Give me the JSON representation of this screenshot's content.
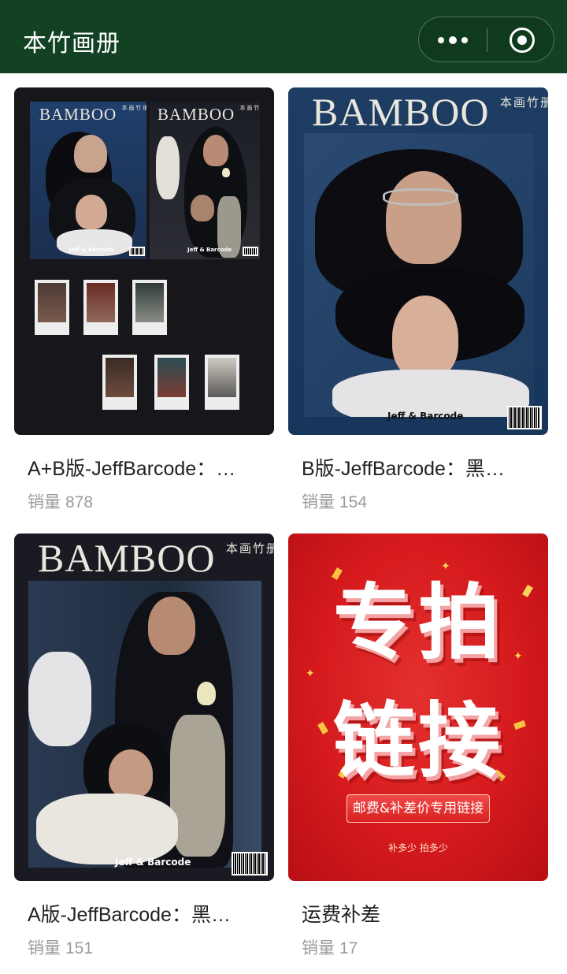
{
  "header": {
    "title": "本竹画册",
    "more_icon": "more-dots-icon",
    "close_icon": "target-circle-icon"
  },
  "colors": {
    "header_bg": "#124223",
    "promo_red": "#d61a1d"
  },
  "products": [
    {
      "title": "A+B版-JeffBarcode：…",
      "sales_label": "销量",
      "sales": "878",
      "cover": {
        "mag_a_brand": "BAMBOO",
        "mag_a_zh": "本画竹册",
        "mag_a_foot": "Jeff & Barcode",
        "mag_b_brand": "BAMBOO",
        "mag_b_zh": "本画竹册",
        "mag_b_foot": "Jeff & Barcode"
      }
    },
    {
      "title": "B版-JeffBarcode：黑…",
      "sales_label": "销量",
      "sales": "154",
      "cover": {
        "brand": "BAMBOO",
        "zh": "本画竹册",
        "foot": "Jeff & Barcode"
      }
    },
    {
      "title": "A版-JeffBarcode：黑…",
      "sales_label": "销量",
      "sales": "151",
      "cover": {
        "brand": "BAMBOO",
        "zh": "本画竹册",
        "foot": "Jeff & Barcode"
      }
    },
    {
      "title": "运费补差",
      "sales_label": "销量",
      "sales": "17",
      "cover": {
        "line1": "专拍",
        "line2": "链接",
        "banner": "邮费&补差价专用链接",
        "sub": "补多少 拍多少"
      }
    }
  ]
}
